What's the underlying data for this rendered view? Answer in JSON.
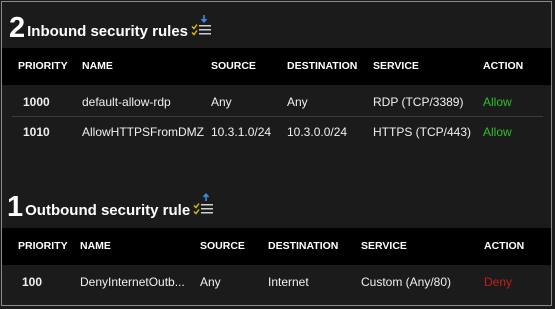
{
  "inbound": {
    "count": "2",
    "title": "Inbound security rules",
    "icon": "download-list-icon",
    "headers": [
      "PRIORITY",
      "NAME",
      "SOURCE",
      "DESTINATION",
      "SERVICE",
      "ACTION"
    ],
    "rows": [
      {
        "priority": "1000",
        "name": "default-allow-rdp",
        "source": "Any",
        "destination": "Any",
        "service": "RDP (TCP/3389)",
        "action": "Allow"
      },
      {
        "priority": "1010",
        "name": "AllowHTTPSFromDMZ",
        "source": "10.3.1.0/24",
        "destination": "10.3.0.0/24",
        "service": "HTTPS (TCP/443)",
        "action": "Allow"
      }
    ]
  },
  "outbound": {
    "count": "1",
    "title": "Outbound security rule",
    "icon": "upload-list-icon",
    "headers": [
      "PRIORITY",
      "NAME",
      "SOURCE",
      "DESTINATION",
      "SERVICE",
      "ACTION"
    ],
    "rows": [
      {
        "priority": "100",
        "name": "DenyInternetOutb...",
        "source": "Any",
        "destination": "Internet",
        "service": "Custom (Any/80)",
        "action": "Deny"
      }
    ]
  },
  "colors": {
    "allow": "#2fbf2f",
    "deny": "#c0221a",
    "arrow": "#3a8ee6",
    "check": "#d9c300"
  }
}
